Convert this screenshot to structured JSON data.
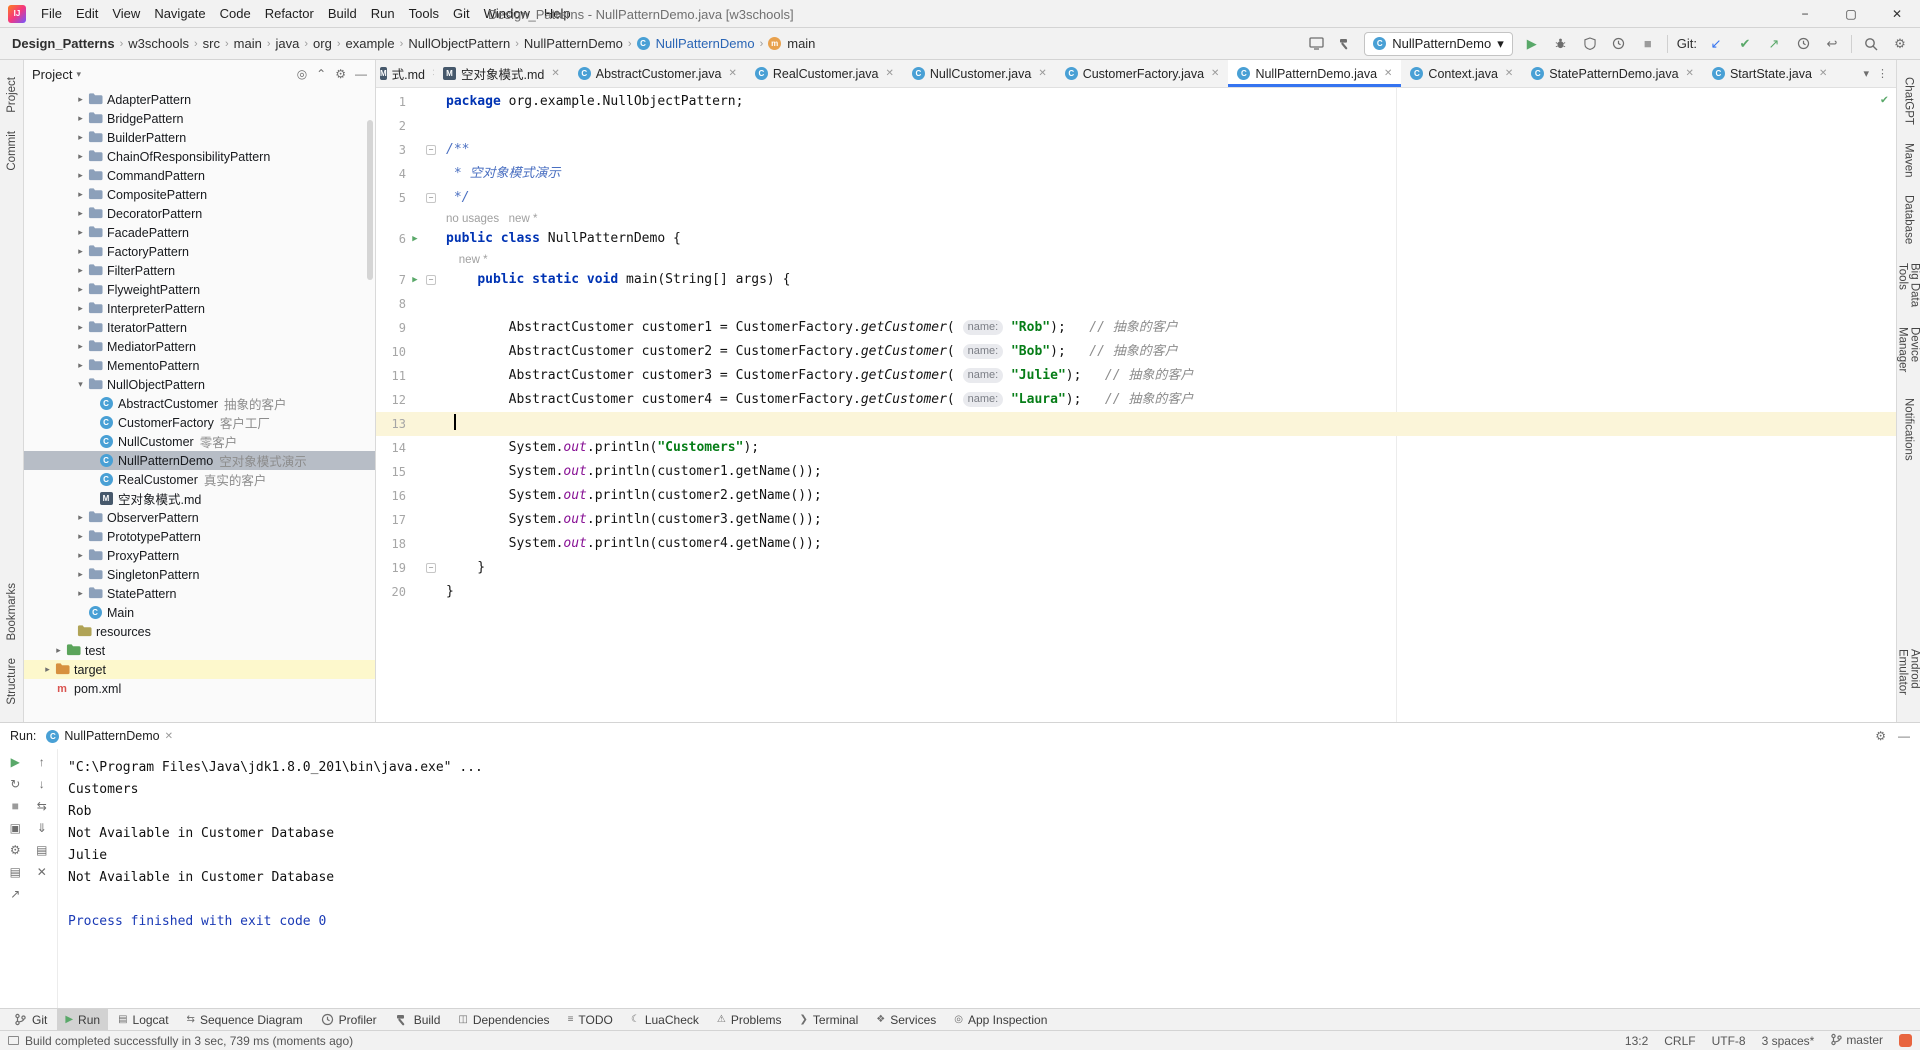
{
  "icons": {
    "minimize": "−",
    "maximize": "▢",
    "close": "✕"
  },
  "title_bar": {
    "menus": [
      "File",
      "Edit",
      "View",
      "Navigate",
      "Code",
      "Refactor",
      "Build",
      "Run",
      "Tools",
      "Git",
      "Window",
      "Help"
    ],
    "title": "Design_Patterns - NullPatternDemo.java [w3schools]"
  },
  "navbar": {
    "breadcrumbs": [
      "Design_Patterns",
      "w3schools",
      "src",
      "main",
      "java",
      "org",
      "example",
      "NullObjectPattern",
      "NullPatternDemo"
    ],
    "class_crumb": "NullPatternDemo",
    "method_crumb": "main",
    "run_config": "NullPatternDemo",
    "git_label": "Git:"
  },
  "left_stripe": {
    "top": [
      "Project",
      "Commit"
    ],
    "bottom": [
      "Bookmarks",
      "Structure"
    ]
  },
  "right_stripe": [
    "ChatGPT",
    "Maven",
    "Database",
    "Big Data Tools",
    "Device Manager",
    "Notifications",
    "Android Emulator"
  ],
  "project_panel": {
    "header": "Project",
    "tree": [
      {
        "label": "AdapterPattern",
        "icon": "folder",
        "level": 4,
        "chevron": "collapsed"
      },
      {
        "label": "BridgePattern",
        "icon": "folder",
        "level": 4,
        "chevron": "collapsed"
      },
      {
        "label": "BuilderPattern",
        "icon": "folder",
        "level": 4,
        "chevron": "collapsed"
      },
      {
        "label": "ChainOfResponsibilityPattern",
        "icon": "folder",
        "level": 4,
        "chevron": "collapsed"
      },
      {
        "label": "CommandPattern",
        "icon": "folder",
        "level": 4,
        "chevron": "collapsed"
      },
      {
        "label": "CompositePattern",
        "icon": "folder",
        "level": 4,
        "chevron": "collapsed"
      },
      {
        "label": "DecoratorPattern",
        "icon": "folder",
        "level": 4,
        "chevron": "collapsed"
      },
      {
        "label": "FacadePattern",
        "icon": "folder",
        "level": 4,
        "chevron": "collapsed"
      },
      {
        "label": "FactoryPattern",
        "icon": "folder",
        "level": 4,
        "chevron": "collapsed"
      },
      {
        "label": "FilterPattern",
        "icon": "folder",
        "level": 4,
        "chevron": "collapsed"
      },
      {
        "label": "FlyweightPattern",
        "icon": "folder",
        "level": 4,
        "chevron": "collapsed"
      },
      {
        "label": "InterpreterPattern",
        "icon": "folder",
        "level": 4,
        "chevron": "collapsed"
      },
      {
        "label": "IteratorPattern",
        "icon": "folder",
        "level": 4,
        "chevron": "collapsed"
      },
      {
        "label": "MediatorPattern",
        "icon": "folder",
        "level": 4,
        "chevron": "collapsed"
      },
      {
        "label": "MementoPattern",
        "icon": "folder",
        "level": 4,
        "chevron": "collapsed"
      },
      {
        "label": "NullObjectPattern",
        "icon": "folder",
        "level": 4,
        "chevron": "expanded"
      },
      {
        "label": "AbstractCustomer",
        "annotation": "抽象的客户",
        "icon": "class",
        "level": 5
      },
      {
        "label": "CustomerFactory",
        "annotation": "客户工厂",
        "icon": "class",
        "level": 5
      },
      {
        "label": "NullCustomer",
        "annotation": "零客户",
        "icon": "class",
        "level": 5
      },
      {
        "label": "NullPatternDemo",
        "annotation": "空对象模式演示",
        "icon": "class",
        "level": 5,
        "selected": true
      },
      {
        "label": "RealCustomer",
        "annotation": "真实的客户",
        "icon": "class",
        "level": 5
      },
      {
        "label": "空对象模式.md",
        "icon": "md",
        "level": 5
      },
      {
        "label": "ObserverPattern",
        "icon": "folder",
        "level": 4,
        "chevron": "collapsed"
      },
      {
        "label": "PrototypePattern",
        "icon": "folder",
        "level": 4,
        "chevron": "collapsed"
      },
      {
        "label": "ProxyPattern",
        "icon": "folder",
        "level": 4,
        "chevron": "collapsed"
      },
      {
        "label": "SingletonPattern",
        "icon": "folder",
        "level": 4,
        "chevron": "collapsed"
      },
      {
        "label": "StatePattern",
        "icon": "folder",
        "level": 4,
        "chevron": "collapsed"
      },
      {
        "label": "Main",
        "icon": "class",
        "level": 4
      },
      {
        "label": "resources",
        "icon": "folder-resources",
        "level": 3
      },
      {
        "label": "test",
        "icon": "folder-test",
        "level": 2,
        "chevron": "collapsed"
      },
      {
        "label": "target",
        "icon": "folder-excluded",
        "level": 1,
        "chevron": "collapsed",
        "rowHighlight": true
      },
      {
        "label": "pom.xml",
        "icon": "maven",
        "level": 1
      }
    ]
  },
  "tabs": [
    {
      "label": "式.md",
      "icon": "md",
      "partial": true
    },
    {
      "label": "空对象模式.md",
      "icon": "md"
    },
    {
      "label": "AbstractCustomer.java",
      "icon": "java"
    },
    {
      "label": "RealCustomer.java",
      "icon": "java"
    },
    {
      "label": "NullCustomer.java",
      "icon": "java"
    },
    {
      "label": "CustomerFactory.java",
      "icon": "java"
    },
    {
      "label": "NullPatternDemo.java",
      "icon": "java",
      "active": true
    },
    {
      "label": "Context.java",
      "icon": "java"
    },
    {
      "label": "StatePatternDemo.java",
      "icon": "java"
    },
    {
      "label": "StartState.java",
      "icon": "java"
    }
  ],
  "editor": {
    "lines": [
      {
        "n": "1",
        "t": [
          [
            "k",
            "package"
          ],
          [
            "p",
            " org.example.NullObjectPattern;"
          ]
        ]
      },
      {
        "n": "2",
        "t": []
      },
      {
        "n": "3",
        "fold": true,
        "t": [
          [
            "d",
            "/**"
          ]
        ]
      },
      {
        "n": "4",
        "t": [
          [
            "d",
            " * 空对象模式演示"
          ]
        ]
      },
      {
        "n": "5",
        "fold": true,
        "t": [
          [
            "d",
            " */"
          ]
        ]
      },
      {
        "inlay": true,
        "t": [
          [
            "g",
            "no usages   new *"
          ]
        ]
      },
      {
        "n": "6",
        "run": true,
        "t": [
          [
            "k",
            "public"
          ],
          [
            "p",
            " "
          ],
          [
            "k",
            "class"
          ],
          [
            "p",
            " NullPatternDemo {"
          ]
        ]
      },
      {
        "inlay": true,
        "t": [
          [
            "g",
            "    new *"
          ]
        ]
      },
      {
        "n": "7",
        "run": true,
        "fold": true,
        "t": [
          [
            "p",
            "    "
          ],
          [
            "k",
            "public"
          ],
          [
            "p",
            " "
          ],
          [
            "k",
            "static"
          ],
          [
            "p",
            " "
          ],
          [
            "k",
            "void"
          ],
          [
            "p",
            " main(String[] args) {"
          ]
        ]
      },
      {
        "n": "8",
        "t": []
      },
      {
        "n": "9",
        "t": [
          [
            "p",
            "        AbstractCustomer customer1 = CustomerFactory."
          ],
          [
            "i",
            "getCustomer"
          ],
          [
            "p",
            "( "
          ],
          [
            "h",
            "name:"
          ],
          [
            "p",
            " "
          ],
          [
            "s",
            "\"Rob\""
          ],
          [
            "p",
            ");   "
          ],
          [
            "c",
            "// 抽象的客户"
          ]
        ]
      },
      {
        "n": "10",
        "t": [
          [
            "p",
            "        AbstractCustomer customer2 = CustomerFactory."
          ],
          [
            "i",
            "getCustomer"
          ],
          [
            "p",
            "( "
          ],
          [
            "h",
            "name:"
          ],
          [
            "p",
            " "
          ],
          [
            "s",
            "\"Bob\""
          ],
          [
            "p",
            ");   "
          ],
          [
            "c",
            "// 抽象的客户"
          ]
        ]
      },
      {
        "n": "11",
        "t": [
          [
            "p",
            "        AbstractCustomer customer3 = CustomerFactory."
          ],
          [
            "i",
            "getCustomer"
          ],
          [
            "p",
            "( "
          ],
          [
            "h",
            "name:"
          ],
          [
            "p",
            " "
          ],
          [
            "s",
            "\"Julie\""
          ],
          [
            "p",
            ");   "
          ],
          [
            "c",
            "// 抽象的客户"
          ]
        ]
      },
      {
        "n": "12",
        "t": [
          [
            "p",
            "        AbstractCustomer customer4 = CustomerFactory."
          ],
          [
            "i",
            "getCustomer"
          ],
          [
            "p",
            "( "
          ],
          [
            "h",
            "name:"
          ],
          [
            "p",
            " "
          ],
          [
            "s",
            "\"Laura\""
          ],
          [
            "p",
            ");   "
          ],
          [
            "c",
            "// 抽象的客户"
          ]
        ]
      },
      {
        "n": "13",
        "hl": true,
        "caret": true,
        "t": [
          [
            "p",
            " "
          ]
        ]
      },
      {
        "n": "14",
        "t": [
          [
            "p",
            "        System."
          ],
          [
            "f",
            "out"
          ],
          [
            "p",
            ".println("
          ],
          [
            "s",
            "\"Customers\""
          ],
          [
            "p",
            ");"
          ]
        ]
      },
      {
        "n": "15",
        "t": [
          [
            "p",
            "        System."
          ],
          [
            "f",
            "out"
          ],
          [
            "p",
            ".println(customer1.getName());"
          ]
        ]
      },
      {
        "n": "16",
        "t": [
          [
            "p",
            "        System."
          ],
          [
            "f",
            "out"
          ],
          [
            "p",
            ".println(customer2.getName());"
          ]
        ]
      },
      {
        "n": "17",
        "t": [
          [
            "p",
            "        System."
          ],
          [
            "f",
            "out"
          ],
          [
            "p",
            ".println(customer3.getName());"
          ]
        ]
      },
      {
        "n": "18",
        "t": [
          [
            "p",
            "        System."
          ],
          [
            "f",
            "out"
          ],
          [
            "p",
            ".println(customer4.getName());"
          ]
        ]
      },
      {
        "n": "19",
        "fold": true,
        "t": [
          [
            "p",
            "    }"
          ]
        ]
      },
      {
        "n": "20",
        "t": [
          [
            "p",
            "}"
          ]
        ]
      }
    ]
  },
  "run_panel": {
    "label": "Run:",
    "tab": "NullPatternDemo",
    "output": [
      {
        "text": "\"C:\\Program Files\\Java\\jdk1.8.0_201\\bin\\java.exe\" ...",
        "style": "plain"
      },
      {
        "text": "Customers",
        "style": "plain"
      },
      {
        "text": "Rob",
        "style": "plain"
      },
      {
        "text": "Not Available in Customer Database",
        "style": "plain"
      },
      {
        "text": "Julie",
        "style": "plain"
      },
      {
        "text": "Not Available in Customer Database",
        "style": "plain"
      },
      {
        "text": "",
        "style": "plain"
      },
      {
        "text": "Process finished with exit code 0",
        "style": "system"
      }
    ]
  },
  "bottom_bar": [
    {
      "label": "Git",
      "icon": "branch"
    },
    {
      "label": "Run",
      "icon": "play",
      "active": true
    },
    {
      "label": "Logcat",
      "icon": "logcat"
    },
    {
      "label": "Sequence Diagram",
      "icon": "seq"
    },
    {
      "label": "Profiler",
      "icon": "profiler"
    },
    {
      "label": "Build",
      "icon": "hammer"
    },
    {
      "label": "Dependencies",
      "icon": "deps"
    },
    {
      "label": "TODO",
      "icon": "todo"
    },
    {
      "label": "LuaCheck",
      "icon": "lua"
    },
    {
      "label": "Problems",
      "icon": "problems"
    },
    {
      "label": "Terminal",
      "icon": "terminal"
    },
    {
      "label": "Services",
      "icon": "services"
    },
    {
      "label": "App Inspection",
      "icon": "inspection"
    }
  ],
  "status_bar": {
    "message": "Build completed successfully in 3 sec, 739 ms (moments ago)",
    "position": "13:2",
    "line_sep": "CRLF",
    "encoding": "UTF-8",
    "indent": "3 spaces*",
    "branch": "master"
  }
}
